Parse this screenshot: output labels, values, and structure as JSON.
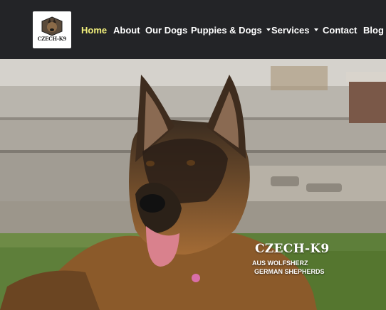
{
  "header": {
    "logo_text": "CZECH-K9",
    "nav": [
      {
        "label": "Home",
        "active": true,
        "has_dropdown": false
      },
      {
        "label": "About",
        "active": false,
        "has_dropdown": false
      },
      {
        "label": "Our Dogs",
        "active": false,
        "has_dropdown": false
      },
      {
        "label": "Puppies & Dogs",
        "active": false,
        "has_dropdown": true
      },
      {
        "label": "Services",
        "active": false,
        "has_dropdown": true
      },
      {
        "label": "Contact",
        "active": false,
        "has_dropdown": false
      },
      {
        "label": "Blog",
        "active": false,
        "has_dropdown": false
      }
    ]
  },
  "hero": {
    "image": "german-shepherd-photo",
    "brand": "CZECH-K9",
    "tagline_line1": "AUS WOLFSHERZ",
    "tagline_line2": "GERMAN SHEPHERDS"
  },
  "colors": {
    "nav_bg": "#232427",
    "active_link": "#f2f07c",
    "link": "#ffffff"
  }
}
